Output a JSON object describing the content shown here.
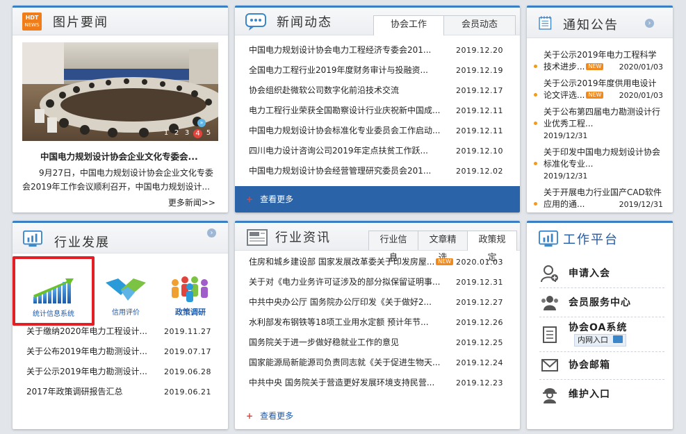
{
  "photo_news": {
    "title": "图片要闻",
    "caption": "中国电力规划设计协会企业文化专委会...",
    "summary": "9月27日，中国电力规划设计协会企业文化专委会2019年工作会议顺利召开，中国电力规划设计...",
    "more": "更多新闻>>",
    "pager": [
      "1",
      "2",
      "3",
      "4",
      "5"
    ],
    "active_page": "4"
  },
  "news": {
    "title": "新闻动态",
    "tabs": [
      "协会工作",
      "会员动态"
    ],
    "items": [
      {
        "title": "中国电力规划设计协会电力工程经济专委会201...",
        "date": "2019.12.20"
      },
      {
        "title": "全国电力工程行业2019年度财务审计与投融资...",
        "date": "2019.12.19"
      },
      {
        "title": "协会组织赴微软公司数字化前沿技术交流",
        "date": "2019.12.17"
      },
      {
        "title": "电力工程行业荣获全国勘察设计行业庆祝新中国成...",
        "date": "2019.12.11"
      },
      {
        "title": "中国电力规划设计协会标准化专业委员会工作启动...",
        "date": "2019.12.11"
      },
      {
        "title": "四川电力设计咨询公司2019年定点扶贫工作跃...",
        "date": "2019.12.10"
      },
      {
        "title": "中国电力规划设计协会经营管理研究委员会201...",
        "date": "2019.12.02"
      }
    ],
    "more": "查看更多"
  },
  "notice": {
    "title": "通知公告",
    "items": [
      {
        "title": "关于公示2019年电力工程科学技术进步...",
        "date": "2020/01/03",
        "new": true
      },
      {
        "title": "关于公示2019年度供用电设计论文评选...",
        "date": "2020/01/03",
        "new": true
      },
      {
        "title": "关于公布第四届电力勘测设计行业优秀工程...",
        "date": "2019/12/31",
        "new": false
      },
      {
        "title": "关于印发中国电力规划设计协会标准化专业...",
        "date": "2019/12/31",
        "new": false
      },
      {
        "title": "关于开展电力行业国产CAD软件应用的通...",
        "date": "2019/12/31",
        "new": false
      }
    ]
  },
  "industry": {
    "title": "行业发展",
    "apps": [
      "统计信息系统",
      "信用评价",
      "政策调研"
    ],
    "items": [
      {
        "title": "关于缴纳2020年电力工程设计...",
        "date": "2019.11.27"
      },
      {
        "title": "关于公布2019年电力勘测设计...",
        "date": "2019.07.17"
      },
      {
        "title": "关于公示2019年电力勘测设计...",
        "date": "2019.06.28"
      },
      {
        "title": "2017年政策调研报告汇总",
        "date": "2019.06.21"
      }
    ]
  },
  "info": {
    "title": "行业资讯",
    "tabs": [
      "行业信息",
      "文章精选",
      "政策规定"
    ],
    "items": [
      {
        "title": "住房和城乡建设部 国家发展改革委关于印发房屋...",
        "date": "2020.01.03",
        "new": true
      },
      {
        "title": "关于对《电力业务许可证涉及的部分拟保留证明事...",
        "date": "2019.12.31",
        "new": false
      },
      {
        "title": "中共中央办公厅 国务院办公厅印发《关于做好2...",
        "date": "2019.12.27",
        "new": false
      },
      {
        "title": "水利部发布钢铁等18项工业用水定额 预计年节...",
        "date": "2019.12.26",
        "new": false
      },
      {
        "title": "国务院关于进一步做好稳就业工作的意见",
        "date": "2019.12.25",
        "new": false
      },
      {
        "title": "国家能源局新能源司负责同志就《关于促进生物天...",
        "date": "2019.12.24",
        "new": false
      },
      {
        "title": "中共中央 国务院关于营造更好发展环境支持民营...",
        "date": "2019.12.23",
        "new": false
      }
    ],
    "more": "查看更多"
  },
  "platform": {
    "title": "工作平台",
    "items": [
      "申请入会",
      "会员服务中心",
      "协会OA系统",
      "协会邮箱",
      "维护入口"
    ],
    "oa_sub": "内网入口"
  },
  "badge_new": "NEW",
  "logo_text": [
    "HDT",
    "NEWS"
  ],
  "colors": {
    "accent": "#3a7fc4",
    "more_bar": "#2a63a8",
    "highlight": "#e31e24",
    "bullet": "#f29a1c"
  }
}
